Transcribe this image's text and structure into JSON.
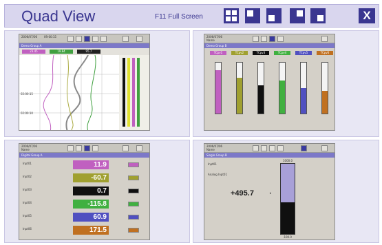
{
  "header": {
    "title": "Quad View",
    "full_screen_label": "F11 Full Screen",
    "close_label": "X",
    "layout_buttons": [
      "quad-layout",
      "top-left-layout",
      "bottom-left-layout",
      "top-right-layout",
      "bottom-right-layout"
    ]
  },
  "panels": {
    "trend": {
      "date": "2006/07/06",
      "time": "09:00:15",
      "group": "Demo Group A",
      "channels": [
        "Chan 1",
        "Chan 2",
        "Chan 3"
      ],
      "values": [
        "23.45",
        "19.84",
        "95.7"
      ],
      "times": [
        "02:00:15",
        "02:00:10"
      ]
    },
    "bars": {
      "date": "2006/07/06",
      "name": "Name",
      "group": "Demo Group B",
      "levels": [
        0.85,
        0.7,
        0.55,
        0.65,
        0.5,
        0.45
      ],
      "colors": [
        "#c060c0",
        "#a0a030",
        "#101010",
        "#40b040",
        "#5050c0",
        "#c07020"
      ],
      "labels": [
        "TCpv1",
        "TCpv2",
        "TCpv3",
        "TCpv4",
        "TCpv5",
        "TCpv6"
      ]
    },
    "digital": {
      "date": "2006/07/06",
      "name": "Name",
      "group": "Digital Group A",
      "rows": [
        {
          "label": "Inpt01",
          "value": "11.9",
          "color": "#c060c0"
        },
        {
          "label": "Inpt02",
          "value": "-60.7",
          "color": "#a0a030"
        },
        {
          "label": "Inpt03",
          "value": "0.7",
          "color": "#101010"
        },
        {
          "label": "Inpt04",
          "value": "-115.8",
          "color": "#40b040"
        },
        {
          "label": "Inpt05",
          "value": "60.9",
          "color": "#5050c0"
        },
        {
          "label": "Inpt06",
          "value": "171.5",
          "color": "#c07020"
        }
      ]
    },
    "single": {
      "date": "2006/07/06",
      "name": "Name",
      "group": "Single Group B",
      "label": "Inpt01",
      "sub_label": "Analog Inpt01",
      "value": "+495.7",
      "level": 0.55,
      "scale_top": "1000.0",
      "scale_bottom": "-100.0"
    }
  }
}
